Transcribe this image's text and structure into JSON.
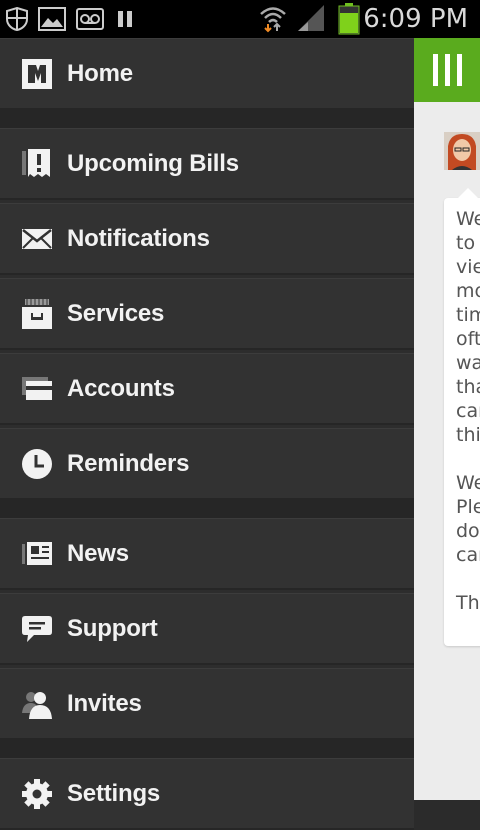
{
  "status_bar": {
    "time": "6:09 PM",
    "icons": [
      "shield-icon",
      "image-icon",
      "voicemail-icon",
      "pause-icon",
      "wifi-icon",
      "signal-icon",
      "battery-icon"
    ]
  },
  "drawer": {
    "items": [
      {
        "label": "Home",
        "icon": "logo-m-icon"
      },
      {
        "label": "Upcoming Bills",
        "icon": "bill-alert-icon"
      },
      {
        "label": "Notifications",
        "icon": "envelope-icon"
      },
      {
        "label": "Services",
        "icon": "services-box-icon"
      },
      {
        "label": "Accounts",
        "icon": "card-icon"
      },
      {
        "label": "Reminders",
        "icon": "clock-icon"
      },
      {
        "label": "News",
        "icon": "newspaper-icon"
      },
      {
        "label": "Support",
        "icon": "chat-bubble-icon"
      },
      {
        "label": "Invites",
        "icon": "users-icon"
      },
      {
        "label": "Settings",
        "icon": "gear-icon"
      }
    ]
  },
  "content": {
    "accent_color": "#5aab1e",
    "message_lines": [
      "We",
      "to",
      "vie",
      "mo",
      "tim",
      "oft",
      "wa",
      "tha",
      "car",
      "thi",
      "",
      "We",
      "Ple",
      "doi",
      "car",
      "",
      "Tha"
    ]
  }
}
